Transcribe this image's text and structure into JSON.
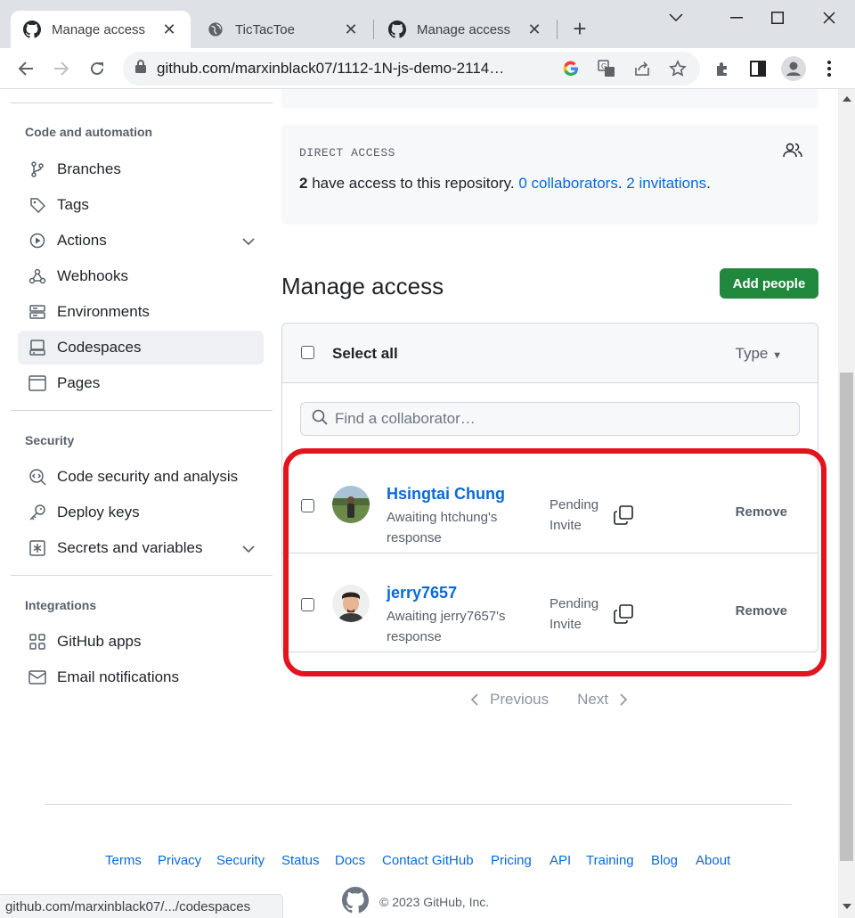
{
  "browser": {
    "tabs": [
      {
        "title": "Manage access",
        "icon": "github-icon",
        "active": true
      },
      {
        "title": "TicTacToe",
        "icon": "globe-icon",
        "active": false
      },
      {
        "title": "Manage access",
        "icon": "github-icon",
        "active": false
      }
    ],
    "url": "github.com/marxinblack07/1112-1N-js-demo-2114…",
    "status_url": "github.com/marxinblack07/.../codespaces"
  },
  "sidebar": {
    "sections": [
      {
        "heading": "Code and automation",
        "items": [
          {
            "label": "Branches",
            "icon": "git-branch-icon"
          },
          {
            "label": "Tags",
            "icon": "tag-icon"
          },
          {
            "label": "Actions",
            "icon": "play-icon",
            "expandable": true
          },
          {
            "label": "Webhooks",
            "icon": "webhook-icon"
          },
          {
            "label": "Environments",
            "icon": "server-icon"
          },
          {
            "label": "Codespaces",
            "icon": "codespaces-icon",
            "selected": true
          },
          {
            "label": "Pages",
            "icon": "browser-icon"
          }
        ]
      },
      {
        "heading": "Security",
        "items": [
          {
            "label": "Code security and analysis",
            "icon": "codescan-icon"
          },
          {
            "label": "Deploy keys",
            "icon": "key-icon"
          },
          {
            "label": "Secrets and variables",
            "icon": "asterisk-icon",
            "expandable": true
          }
        ]
      },
      {
        "heading": "Integrations",
        "items": [
          {
            "label": "GitHub apps",
            "icon": "apps-icon"
          },
          {
            "label": "Email notifications",
            "icon": "mail-icon"
          }
        ]
      }
    ]
  },
  "direct_access": {
    "label": "DIRECT ACCESS",
    "count": "2",
    "text": " have access to this repository. ",
    "collaborators_link": "0 collaborators",
    "sep": ". ",
    "invitations_link": "2 invitations",
    "end": "."
  },
  "manage": {
    "title": "Manage access",
    "add_button": "Add people",
    "select_all": "Select all",
    "type_filter": "Type",
    "search_placeholder": "Find a collaborator…",
    "collaborators": [
      {
        "name": "Hsingtai Chung",
        "status": "Awaiting htchung's response",
        "state_line1": "Pending",
        "state_line2": "Invite",
        "remove": "Remove"
      },
      {
        "name": "jerry7657",
        "status": "Awaiting jerry7657's response",
        "state_line1": "Pending",
        "state_line2": "Invite",
        "remove": "Remove"
      }
    ],
    "pagination": {
      "previous": "Previous",
      "next": "Next"
    }
  },
  "footer": {
    "links": [
      "Terms",
      "Privacy",
      "Security",
      "Status",
      "Docs",
      "Contact GitHub",
      "Pricing",
      "API",
      "Training",
      "Blog",
      "About"
    ],
    "copyright": "© 2023 GitHub, Inc."
  },
  "colors": {
    "link": "#0969da",
    "primary_button": "#1f883d",
    "highlight": "#e3141e"
  }
}
